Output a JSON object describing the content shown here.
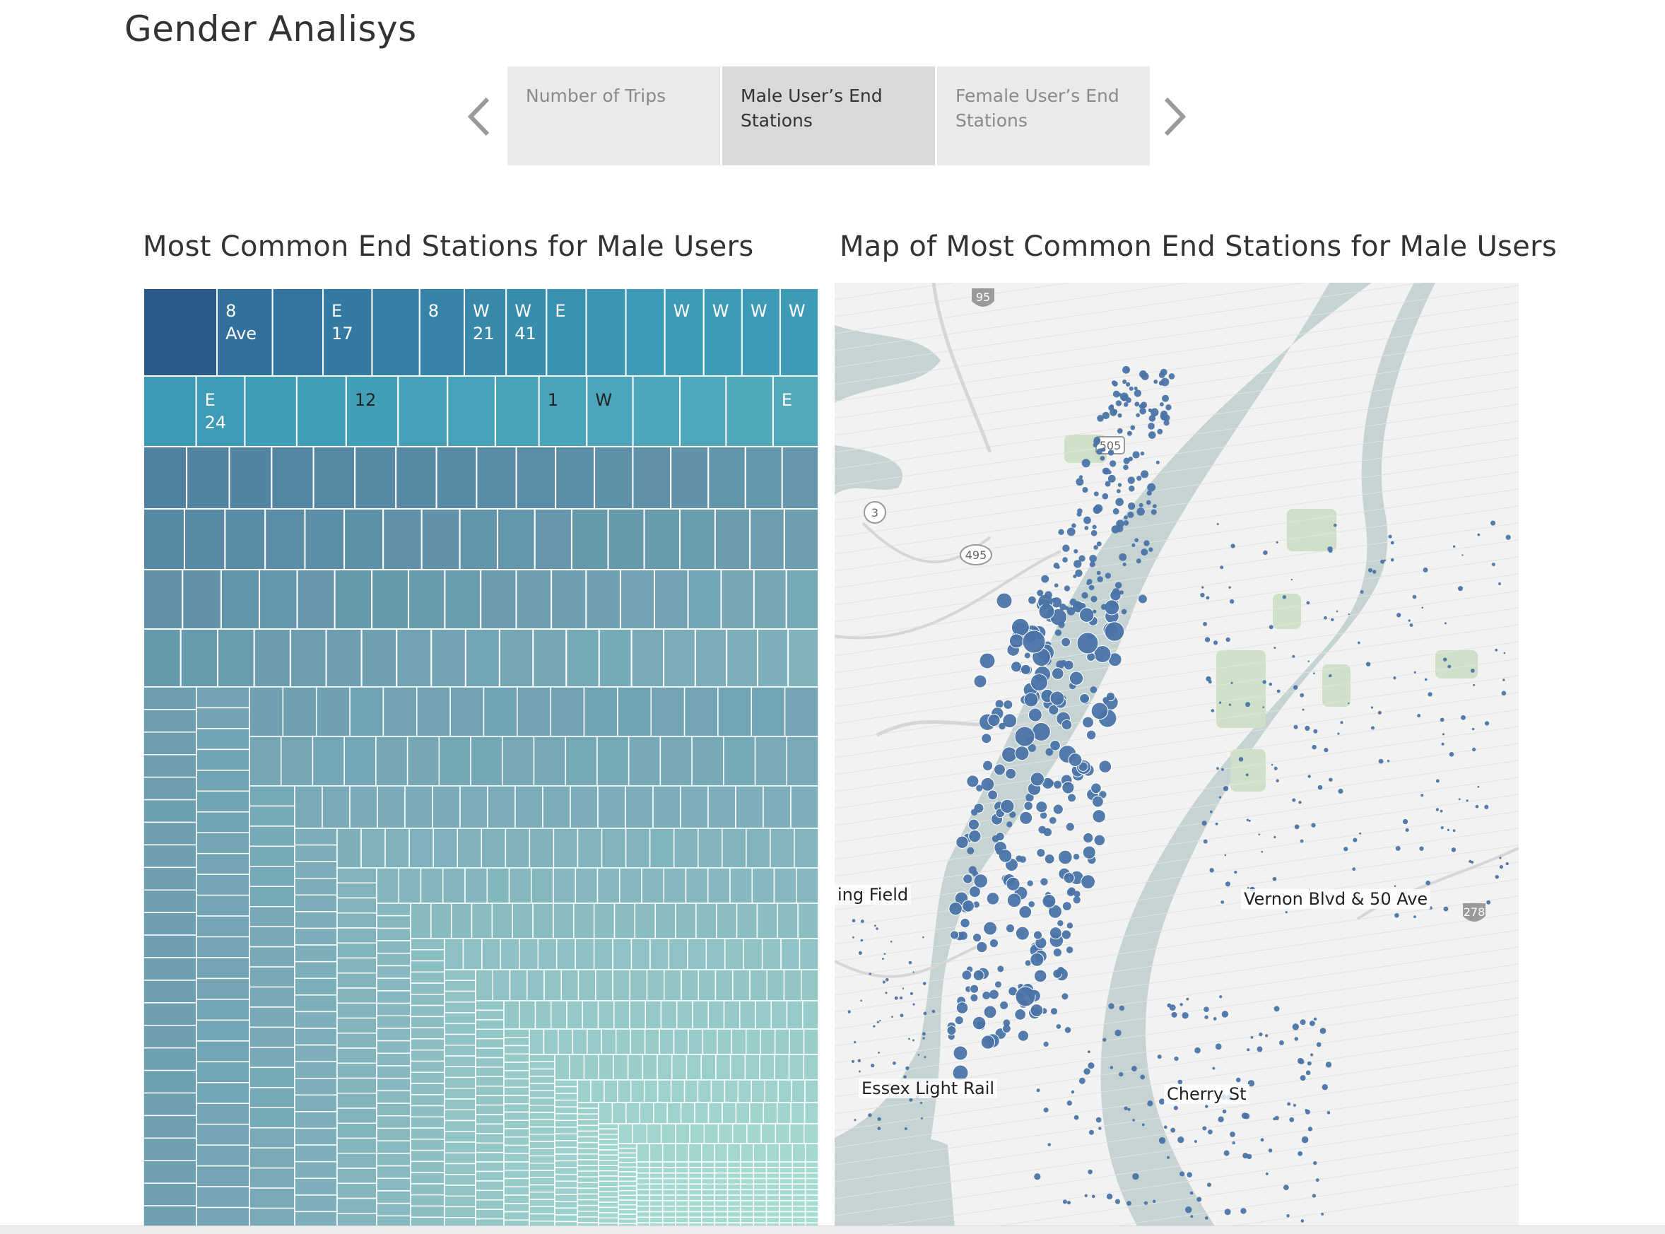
{
  "story": {
    "title": "Gender Analisys",
    "points": [
      {
        "label": "Number of Trips"
      },
      {
        "label": "Male User’s End Stations",
        "active": true
      },
      {
        "label": "Female User’s End Stations"
      }
    ]
  },
  "treemap": {
    "title": "Most Common End Stations for Male Users",
    "labels": [
      "8 Ave",
      "E 17",
      "8",
      "W 21",
      "W 41",
      "E",
      "W",
      "W",
      "W",
      "W",
      "E 24",
      "12",
      "1",
      "W",
      "E"
    ],
    "color_dark": "#2b5a8a",
    "color_light": "#a8ddd3"
  },
  "map": {
    "title": "Map of Most Common End Stations for Male Users",
    "labels": [
      "ing Field",
      "Vernon Blvd & 50 Ave",
      "Essex Light Rail",
      "Cherry St"
    ],
    "road_shields": [
      "95",
      "505",
      "3",
      "495",
      "278"
    ],
    "point_color": "#4a74a8",
    "water_color": "#c5d3d3",
    "land_color": "#f2f2f0",
    "park_color": "#cfe0c8"
  }
}
